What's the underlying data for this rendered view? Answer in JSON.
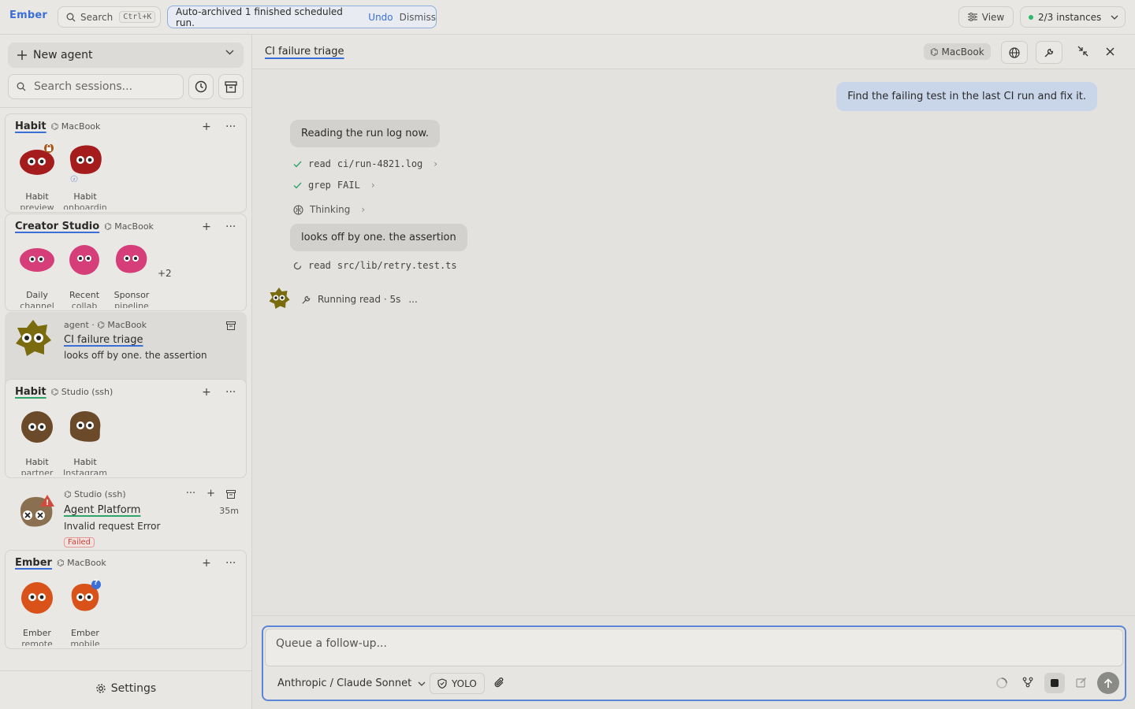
{
  "topbar": {
    "brand": "Ember",
    "search_label": "Search",
    "search_shortcut": "Ctrl+K",
    "toast_text": "Auto-archived 1 finished scheduled run.",
    "toast_undo": "Undo",
    "toast_dismiss": "Dismiss",
    "view_label": "View",
    "instances_label": "2/3 instances"
  },
  "sidebar": {
    "new_agent_label": "New agent",
    "search_placeholder": "Search sessions...",
    "groups": [
      {
        "title": "Habit",
        "machine": "MacBook",
        "agents": [
          {
            "name": "Habit",
            "sub": "preview",
            "color": "#a51c1c",
            "badge": "lock"
          },
          {
            "name": "Habit",
            "sub": "onboardin",
            "color": "#a51c1c"
          }
        ]
      },
      {
        "title": "Creator Studio",
        "machine": "MacBook",
        "more": "+2",
        "agents": [
          {
            "name": "Daily",
            "sub": "channel",
            "color": "#d63e7a"
          },
          {
            "name": "Recent",
            "sub": "collab",
            "color": "#d63e7a"
          },
          {
            "name": "Sponsor",
            "sub": "pipeline",
            "color": "#d63e7a"
          }
        ]
      },
      {
        "title": "Habit",
        "machine": "Studio (ssh)",
        "agents": [
          {
            "name": "Habit",
            "sub": "partner",
            "color": "#6b4a2a"
          },
          {
            "name": "Habit",
            "sub": "Instagram",
            "color": "#6b4a2a"
          }
        ]
      },
      {
        "title": "Ember",
        "machine": "MacBook",
        "agents": [
          {
            "name": "Ember",
            "sub": "remote",
            "color": "#d8521a"
          },
          {
            "name": "Ember",
            "sub": "mobile",
            "color": "#d8521a",
            "badge": "?"
          }
        ]
      }
    ],
    "active_session": {
      "meta": "agent · ⌬ MacBook",
      "title": "CI failure triage",
      "preview": "looks off by one. the assertion"
    },
    "failed_session": {
      "machine": "Studio (ssh)",
      "title": "Agent Platform",
      "error": "Invalid request Error",
      "status": "Failed",
      "time": "35m"
    },
    "settings_label": "Settings"
  },
  "main": {
    "title": "CI failure triage",
    "machine": "MacBook",
    "messages": {
      "user_1": "Find the failing test in the last CI run and fix it.",
      "agent_1": "Reading the run log now.",
      "tool_1_name": "read",
      "tool_1_arg": "ci/run-4821.log",
      "tool_2_name": "grep",
      "tool_2_arg": "FAIL",
      "thinking": "Thinking",
      "agent_2": "looks off by one. the assertion",
      "tool_3_name": "read",
      "tool_3_arg": "src/lib/retry.test.ts",
      "running": "Running read · 5s",
      "running_ellipsis": "..."
    },
    "composer": {
      "placeholder": "Queue a follow-up...",
      "model": "Anthropic / Claude Sonnet",
      "mode": "YOLO"
    }
  },
  "colors": {
    "accent": "#3a6fd8",
    "success": "#2fb86a",
    "danger": "#c7433a"
  }
}
